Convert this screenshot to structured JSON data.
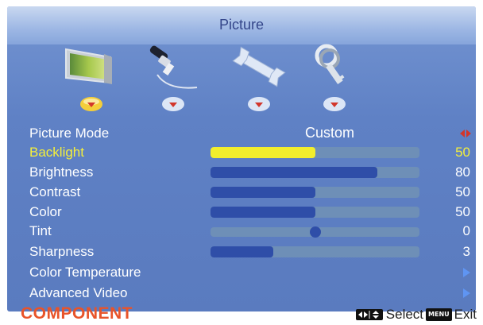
{
  "header": {
    "title": "Picture"
  },
  "icons": [
    {
      "name": "picture-monitor-icon"
    },
    {
      "name": "audio-cable-icon"
    },
    {
      "name": "setup-wrench-icon"
    },
    {
      "name": "lock-key-icon"
    }
  ],
  "menu": {
    "picture_mode": {
      "label": "Picture Mode",
      "value": "Custom"
    },
    "items": [
      {
        "label": "Backlight",
        "value": "50",
        "fill": 0.5,
        "active": true
      },
      {
        "label": "Brightness",
        "value": "80",
        "fill": 0.8
      },
      {
        "label": "Contrast",
        "value": "50",
        "fill": 0.5
      },
      {
        "label": "Color",
        "value": "50",
        "fill": 0.5
      },
      {
        "label": "Tint",
        "value": "0",
        "center": 0.5
      },
      {
        "label": "Sharpness",
        "value": "3",
        "fill": 0.3
      }
    ],
    "submenus": [
      {
        "label": "Color Temperature"
      },
      {
        "label": "Advanced Video"
      }
    ]
  },
  "footer": {
    "source": "COMPONENT",
    "select_label": "Select",
    "menu_key": "MENU",
    "exit_label": "Exit"
  },
  "colors": {
    "accent": "#f2ee2c",
    "bar": "#2f4ea8",
    "source": "#e8542a"
  }
}
